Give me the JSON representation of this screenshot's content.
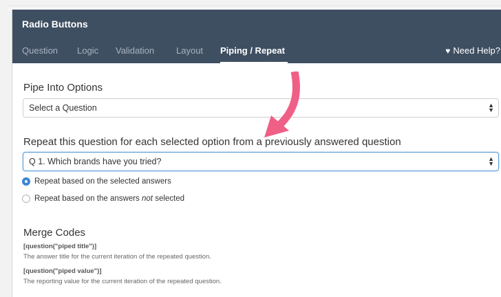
{
  "dialog": {
    "title": "Radio Buttons",
    "tabs": [
      {
        "label": "Question"
      },
      {
        "label": "Logic"
      },
      {
        "label": "Validation"
      },
      {
        "label": "Layout"
      },
      {
        "label": "Piping / Repeat"
      }
    ],
    "active_tab": "Piping / Repeat",
    "help_label": "Need Help?"
  },
  "pipe_into": {
    "title": "Pipe Into Options",
    "selected": "Select a Question"
  },
  "repeat": {
    "title": "Repeat this question for each selected option from a previously answered question",
    "selected": "Q 1. Which brands have you tried?",
    "options": [
      {
        "label": "Repeat based on the selected answers",
        "checked": true
      },
      {
        "label_prefix": "Repeat based on the answers ",
        "label_em": "not",
        "label_suffix": " selected",
        "checked": false
      }
    ]
  },
  "merge_codes": {
    "title": "Merge Codes",
    "items": [
      {
        "code": "[question(\"piped title\")]",
        "description": "The answer title for the current iteration of the repeated question."
      },
      {
        "code": "[question(\"piped value\")]",
        "description": "The reporting value for the current iteration of the repeated question."
      }
    ]
  },
  "colors": {
    "header_bg": "#3f4f62",
    "accent_blue": "#3a86d4",
    "arrow_pink": "#ef5f86"
  }
}
